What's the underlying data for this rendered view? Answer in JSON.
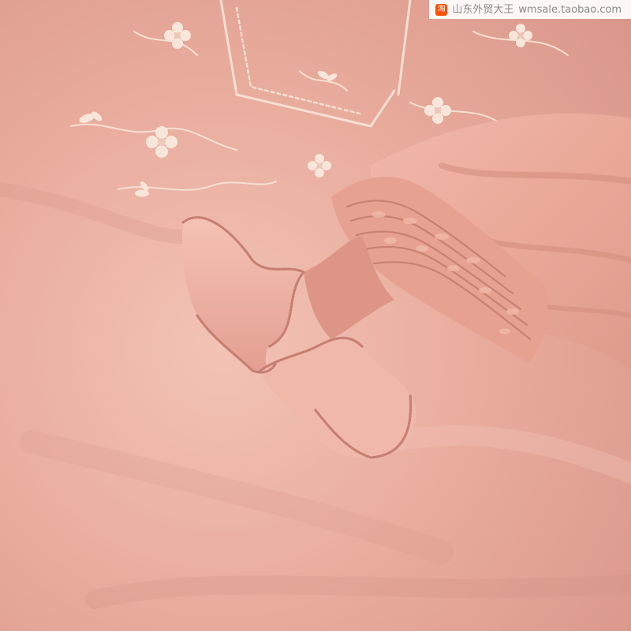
{
  "watermark": {
    "logo_glyph": "淘",
    "shop_name": "山东外贸大王",
    "url": "wmsale.taobao.com",
    "logo_color": "#ff5000"
  },
  "colors": {
    "fabric_base": "#e8aa9c",
    "fabric_light": "#f3c6ba",
    "fabric_shadow": "#cf8f82",
    "embroidery_thread": "#f7e3d6",
    "seam_stitch": "#c98275"
  }
}
